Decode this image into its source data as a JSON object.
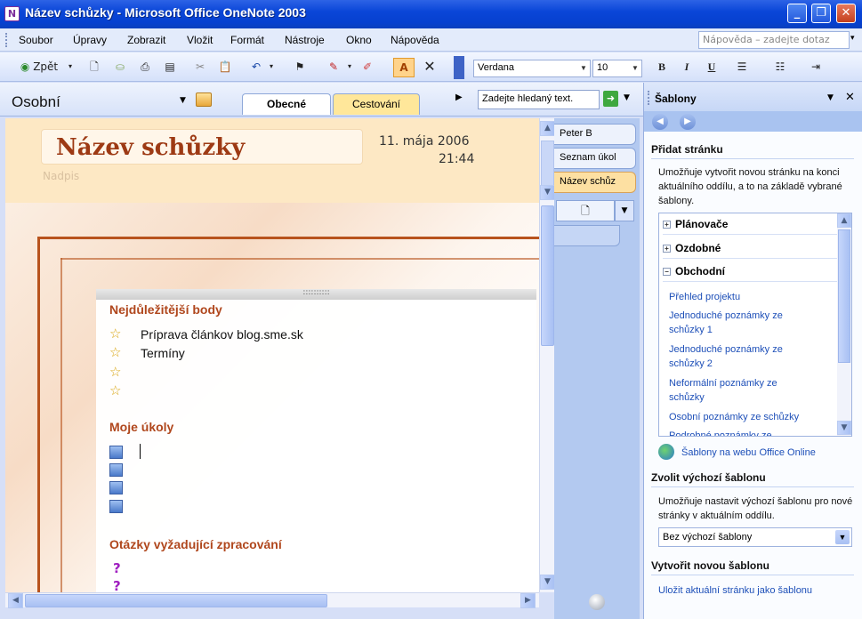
{
  "window": {
    "title": "Název schůzky - Microsoft Office OneNote 2003",
    "app_icon": "onenote-app-icon"
  },
  "menu": {
    "items": [
      "Soubor",
      "Úpravy",
      "Zobrazit",
      "Vložit",
      "Formát",
      "Nástroje",
      "Okno",
      "Nápověda"
    ],
    "help_placeholder": "Nápověda – zadejte dotaz"
  },
  "toolbar": {
    "back_label": "Zpět",
    "font": "Verdana",
    "size": "10",
    "bold": "B",
    "italic": "I",
    "underline": "U"
  },
  "notebook": {
    "section": "Osobní",
    "tabs": [
      {
        "label": "Obecné",
        "color": "#ffffff"
      },
      {
        "label": "Cestování",
        "color": "#ffe79a"
      }
    ],
    "search_placeholder": "Zadejte hledaný text."
  },
  "page": {
    "title": "Název schůzky",
    "date": "11. mája 2006",
    "time": "21:44",
    "subtitle": "Nadpis",
    "handle": "::::::::::",
    "sections": {
      "important": {
        "heading": "Nejdůležitější body",
        "items": [
          "Príprava článkov blog.sme.sk",
          "Termíny",
          "",
          ""
        ]
      },
      "tasks": {
        "heading": "Moje úkoly"
      },
      "questions": {
        "heading": "Otázky vyžadující zpracování"
      }
    },
    "accent_color": "#b0471d"
  },
  "page_tabs": [
    "Peter B",
    "Seznam úkol",
    "Název schůz"
  ],
  "taskpane": {
    "title": "Šablony",
    "add_page": {
      "heading": "Přidat stránku",
      "description": "Umožňuje vytvořit novou stránku na konci aktuálního oddílu, a to na základě vybrané šablony.",
      "groups": [
        "Plánovače",
        "Ozdobné",
        "Obchodní"
      ],
      "templates": [
        "Přehled projektu",
        "Jednoduché poznámky ze schůzky 1",
        "Jednoduché poznámky ze schůzky 2",
        "Neformální poznámky ze schůzky",
        "Osobní poznámky ze schůzky",
        "Podrobné poznámky ze"
      ]
    },
    "online_link": "Šablony na webu Office Online",
    "default_template": {
      "heading": "Zvolit výchozí šablonu",
      "description": "Umožňuje nastavit výchozí šablonu pro nové stránky v aktuálním oddílu.",
      "selected": "Bez výchozí šablony"
    },
    "new_template": {
      "heading": "Vytvořit novou šablonu",
      "save_link": "Uložit aktuální stránku jako šablonu"
    }
  }
}
